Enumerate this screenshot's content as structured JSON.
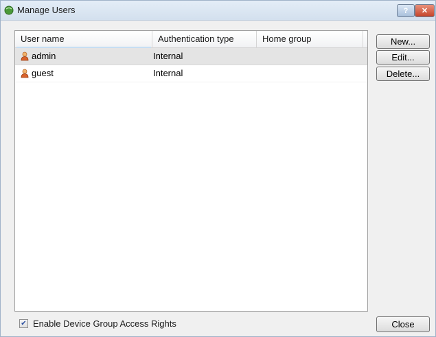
{
  "window": {
    "title": "Manage Users",
    "help_label": "?",
    "close_label": "✕"
  },
  "table": {
    "columns": [
      "User name",
      "Authentication type",
      "Home group"
    ],
    "rows": [
      {
        "user": "admin",
        "auth": "Internal",
        "home": "",
        "selected": true
      },
      {
        "user": "guest",
        "auth": "Internal",
        "home": "",
        "selected": false
      }
    ]
  },
  "buttons": {
    "new": "New...",
    "edit": "Edit...",
    "delete": "Delete...",
    "close": "Close"
  },
  "options": {
    "enable_device_group": {
      "label": "Enable Device Group Access Rights",
      "checked": true
    }
  },
  "icons": {
    "app": "app-globe-icon",
    "user": "user-icon"
  },
  "colors": {
    "title_bg": "#d3e0ee",
    "selected_row": "#e4e4e4",
    "user_icon": "#d9622b"
  }
}
